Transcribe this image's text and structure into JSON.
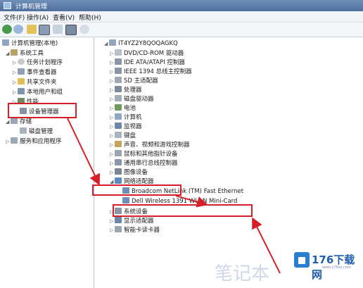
{
  "window": {
    "title": "计算机管理"
  },
  "menu": [
    "文件(F)",
    "操作(A)",
    "查看(V)",
    "帮助(H)"
  ],
  "left_tree": {
    "root": "计算机管理(本地)",
    "system_tools": "系统工具",
    "items": [
      "任务计划程序",
      "事件查看器",
      "共享文件夹",
      "本地用户和组",
      "性能",
      "设备管理器"
    ],
    "storage": "存储",
    "disk_mgmt": "磁盘管理",
    "services": "服务和应用程序"
  },
  "right_tree": {
    "computer_name": "IT4YZ2Y8QOQAGKQ",
    "devices": [
      "DVD/CD-ROM 驱动器",
      "IDE ATA/ATAPI 控制器",
      "IEEE 1394 总线主控制器",
      "SD 主适配器",
      "处理器",
      "磁盘驱动器",
      "电池",
      "计算机",
      "监视器",
      "键盘",
      "声音、视频和游戏控制器",
      "鼠标和其他指针设备",
      "通用串行总线控制器",
      "图像设备",
      "网络适配器",
      "系统设备",
      "显示适配器",
      "智能卡读卡器"
    ],
    "network_children": [
      "Broadcom NetLink (TM) Fast Ethernet",
      "Dell Wireless 1391 WLAN Mini-Card"
    ]
  },
  "watermark": {
    "brand": "176下载网",
    "url": "www.176xz.com",
    "bg_text": "笔记本"
  },
  "colors": {
    "highlight": "#d5202a",
    "titlebar": "#4f6f9c"
  }
}
